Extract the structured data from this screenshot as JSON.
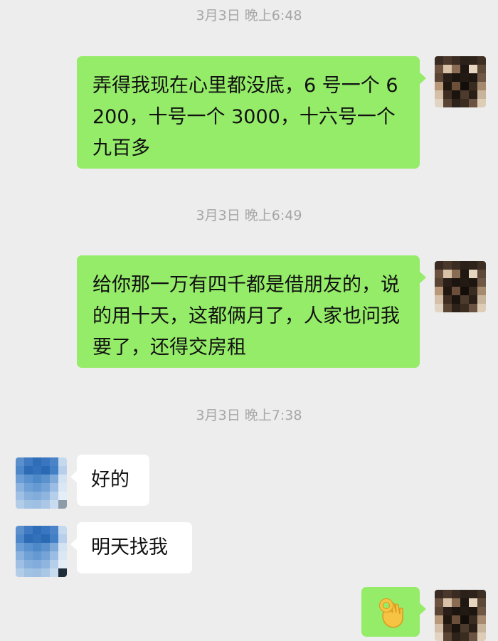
{
  "messages": [
    {
      "type": "timestamp",
      "text": "3月3日 晚上6:48"
    },
    {
      "type": "sent",
      "text": "弄得我现在心里都没底，6 号一个 6200，十号一个 3000，十六号一个九百多"
    },
    {
      "type": "timestamp",
      "text": "3月3日 晚上6:49"
    },
    {
      "type": "sent",
      "text": "给你那一万有四千都是借朋友的，说的用十天，这都俩月了，人家也问我要了，还得交房租"
    },
    {
      "type": "timestamp",
      "text": "3月3日 晚上7:38"
    },
    {
      "type": "received",
      "text": "好的"
    },
    {
      "type": "received",
      "text": "明天找我"
    },
    {
      "type": "sent",
      "emoji": "ok-hand-emoji"
    }
  ],
  "colors": {
    "background": "#ededed",
    "sent_bubble": "#95ec69",
    "received_bubble": "#ffffff",
    "timestamp_text": "#a6a6a6"
  }
}
